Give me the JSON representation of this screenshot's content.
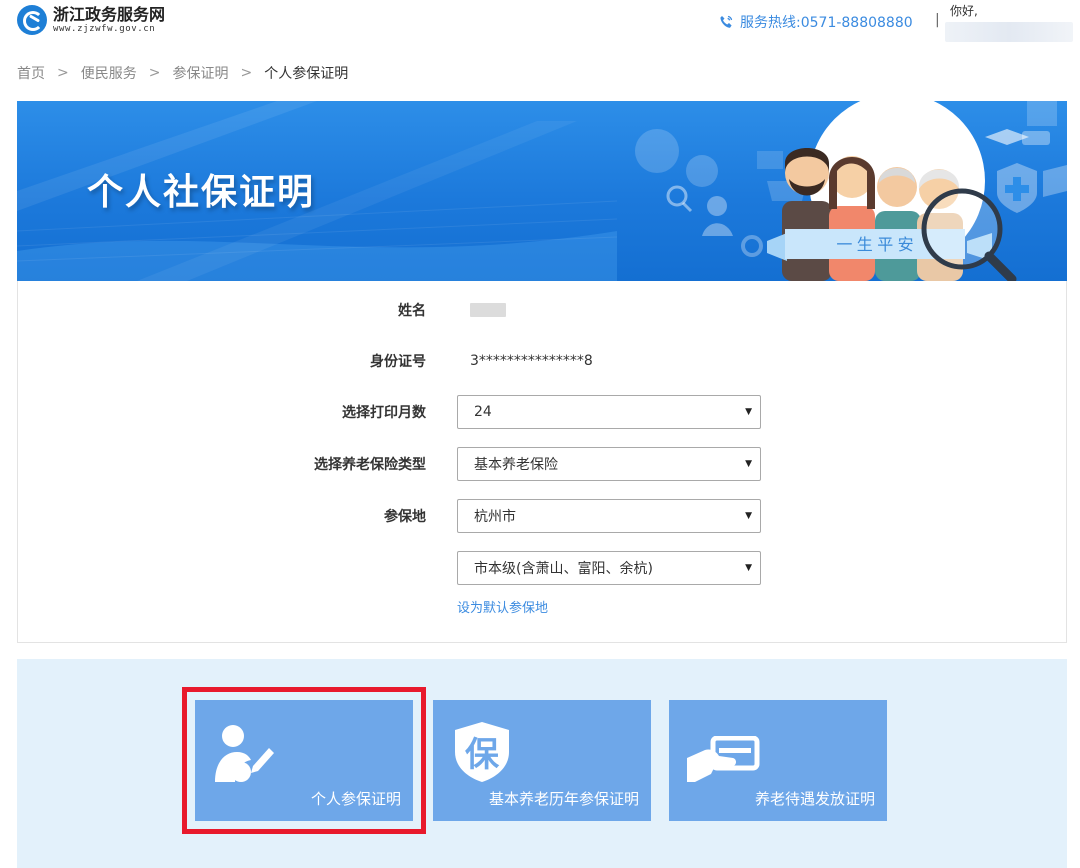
{
  "header": {
    "logo_title": "浙江政务服务网",
    "logo_url": "www.zjzwfw.gov.cn",
    "hotline": "服务热线:0571-88808880",
    "divider": "|",
    "greeting": "你好,"
  },
  "breadcrumb": {
    "items": [
      "首页",
      "便民服务",
      "参保证明"
    ],
    "current": "个人参保证明",
    "separator": ">"
  },
  "banner": {
    "title": "个人社保证明",
    "ribbon": "一 生 平 安"
  },
  "form": {
    "name_label": "姓名",
    "id_label": "身份证号",
    "id_value": "3***************8",
    "months_label": "选择打印月数",
    "months_value": "24",
    "type_label": "选择养老保险类型",
    "type_value": "基本养老保险",
    "place_label": "参保地",
    "place_value": "杭州市",
    "district_value": "市本级(含萧山、富阳、余杭)",
    "default_link": "设为默认参保地"
  },
  "cards": [
    {
      "label": "个人参保证明",
      "icon": "person-edit-icon",
      "selected": true
    },
    {
      "label": "基本养老历年参保证明",
      "icon": "shield-bao-icon",
      "selected": false
    },
    {
      "label": "养老待遇发放证明",
      "icon": "hand-card-icon",
      "selected": false
    }
  ],
  "colors": {
    "accent": "#3b8be0",
    "banner": "#1c79db",
    "card": "#6ea7e9",
    "highlight": "#e8192c"
  }
}
